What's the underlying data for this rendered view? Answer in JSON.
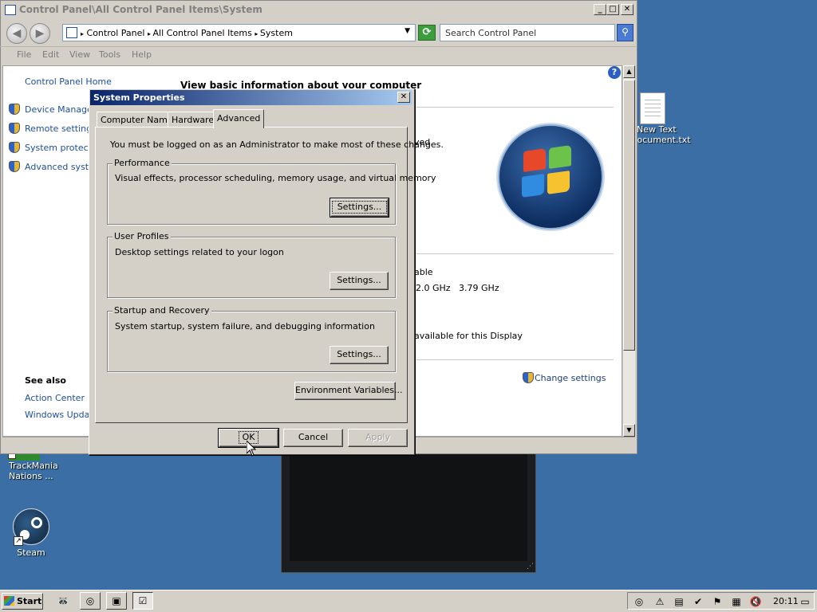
{
  "explorer": {
    "title": "Control Panel\\All Control Panel Items\\System",
    "breadcrumbs": [
      "Control Panel",
      "All Control Panel Items",
      "System"
    ],
    "search_placeholder": "Search Control Panel",
    "menu": [
      "File",
      "Edit",
      "View",
      "Tools",
      "Help"
    ],
    "sidebar": {
      "home": "Control Panel Home",
      "items": [
        "Device Manager",
        "Remote settings",
        "System protectio",
        "Advanced syster"
      ],
      "see_also_heading": "See also",
      "see_also": [
        "Action Center",
        "Windows Update"
      ]
    },
    "main": {
      "heading": "View basic information about your computer",
      "fragments": {
        "rights": "ved.",
        "available": "able",
        "processor": "2.0 GHz   3.79 GHz",
        "display": "available for this Display",
        "change_settings": "Change settings"
      }
    }
  },
  "dialog": {
    "title": "System Properties",
    "close_glyph": "✕",
    "tabs": [
      "Computer Name",
      "Hardware",
      "Advanced"
    ],
    "active_tab": "Advanced",
    "admin_note": "You must be logged on as an Administrator to make most of these changes.",
    "groups": [
      {
        "label": "Performance",
        "description": "Visual effects, processor scheduling, memory usage, and virtual memory",
        "button": "Settings..."
      },
      {
        "label": "User Profiles",
        "description": "Desktop settings related to your logon",
        "button": "Settings..."
      },
      {
        "label": "Startup and Recovery",
        "description": "System startup, system failure, and debugging information",
        "button": "Settings..."
      }
    ],
    "env_button": "Environment Variables...",
    "ok": "OK",
    "cancel": "Cancel",
    "apply": "Apply"
  },
  "desktop": {
    "icons": {
      "new_text": [
        "New Text",
        "Document.txt"
      ],
      "trackmania": [
        "TrackMania",
        "Nations ..."
      ],
      "steam": "Steam"
    }
  },
  "taskbar": {
    "start": "Start",
    "clock": "20:11"
  },
  "colors": {
    "desktop": "#3a6ea5",
    "title_active_start": "#0a246a",
    "title_active_end": "#a6caf0",
    "link": "#1e4fa0"
  }
}
